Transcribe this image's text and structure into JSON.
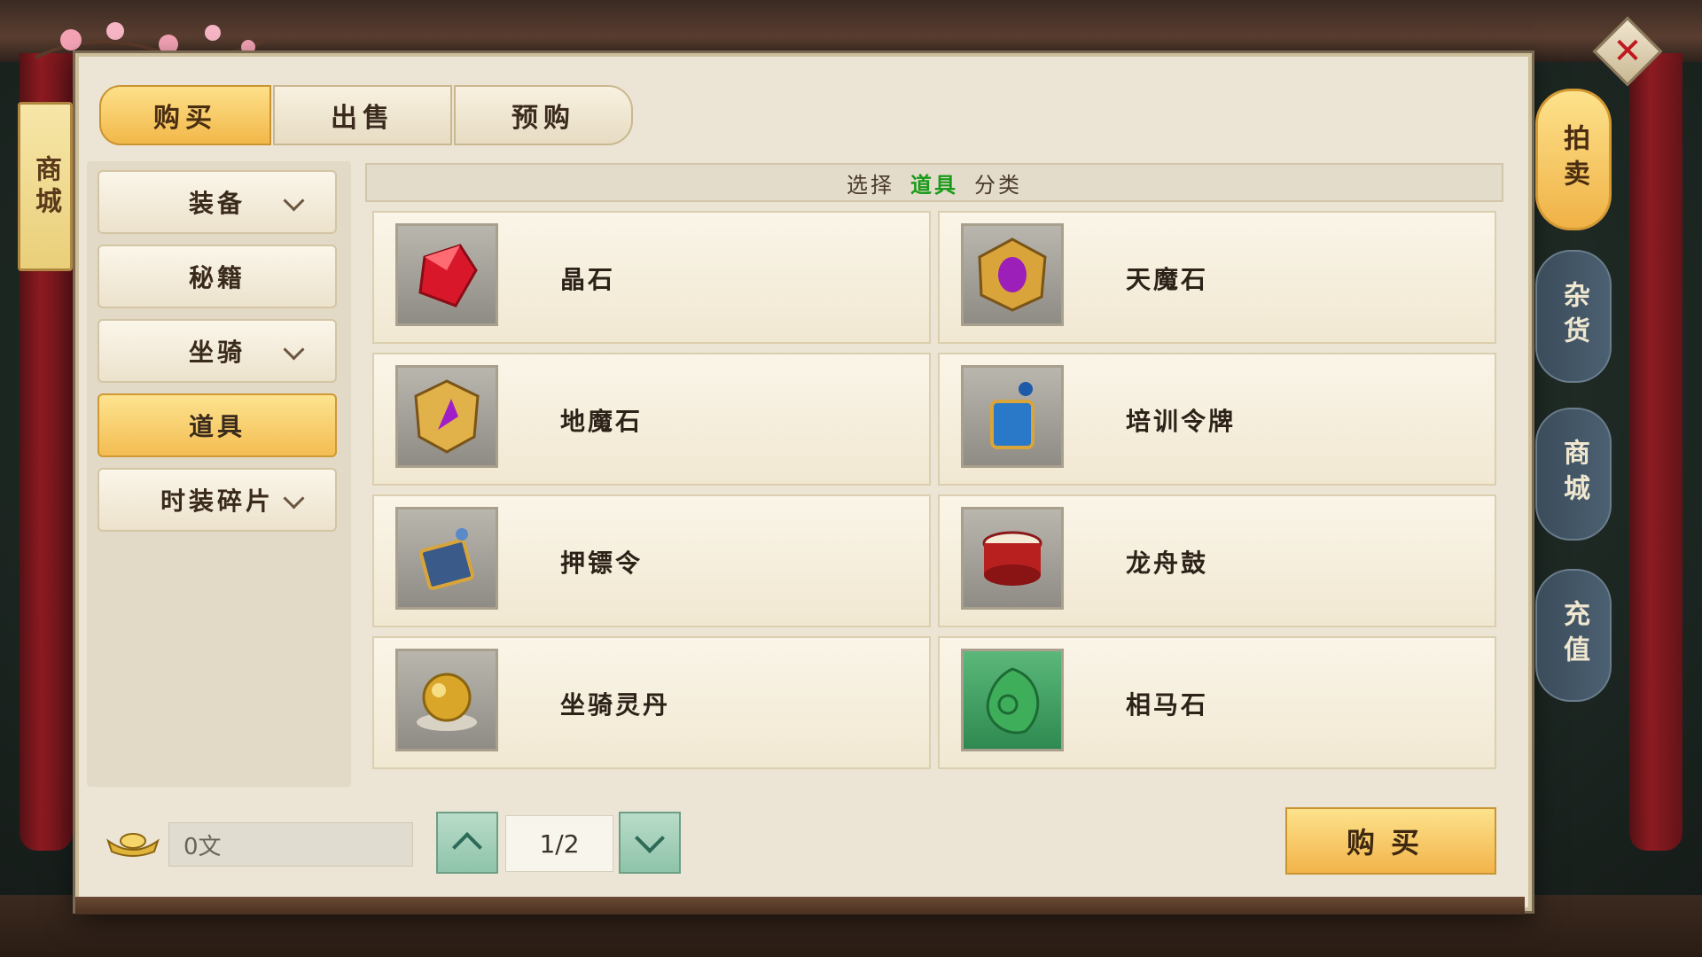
{
  "store_title": "商城",
  "tabs": [
    {
      "label": "购买",
      "active": true
    },
    {
      "label": "出售",
      "active": false
    },
    {
      "label": "预购",
      "active": false
    }
  ],
  "categories": [
    {
      "label": "装备",
      "has_chevron": true
    },
    {
      "label": "秘籍",
      "has_chevron": false
    },
    {
      "label": "坐骑",
      "has_chevron": true
    },
    {
      "label": "道具",
      "has_chevron": false,
      "active": true
    },
    {
      "label": "时装碎片",
      "has_chevron": true
    }
  ],
  "header": {
    "prefix": "选择",
    "highlight": "道具",
    "suffix": "分类"
  },
  "items": [
    {
      "name": "晶石",
      "icon": "red-crystal-icon"
    },
    {
      "name": "天魔石",
      "icon": "purple-gem-amulet-icon"
    },
    {
      "name": "地魔石",
      "icon": "golden-emblem-icon"
    },
    {
      "name": "培训令牌",
      "icon": "blue-token-icon"
    },
    {
      "name": "押镖令",
      "icon": "escort-token-icon"
    },
    {
      "name": "龙舟鼓",
      "icon": "dragon-boat-drum-icon"
    },
    {
      "name": "坐骑灵丹",
      "icon": "golden-pill-icon"
    },
    {
      "name": "相马石",
      "icon": "jade-stone-icon"
    }
  ],
  "money": {
    "value": "0文",
    "icon": "gold-ingot-icon"
  },
  "pagination": {
    "current": "1/2"
  },
  "buy_button": {
    "label": "购买"
  },
  "side_tabs": [
    {
      "label": "拍卖",
      "active": true
    },
    {
      "label": "杂货",
      "active": false
    },
    {
      "label": "商城",
      "active": false
    },
    {
      "label": "充值",
      "active": false
    }
  ],
  "colors": {
    "accent_gold": "#f2b84a",
    "highlight_green": "#1a9a1a",
    "close_red": "#c0181e"
  }
}
